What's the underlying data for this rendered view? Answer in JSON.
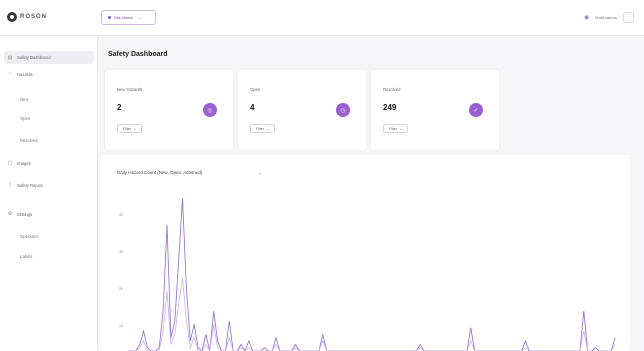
{
  "header": {
    "logo_text": "ROSON",
    "site_label": "Site Name",
    "notifications_label": "Notifications"
  },
  "sidebar": {
    "items": [
      {
        "label": "Safety Dashboard",
        "icon": "dashboard-icon"
      },
      {
        "label": "Hazards",
        "icon": "alert-icon"
      },
      {
        "label": "New",
        "icon": ""
      },
      {
        "label": "Open",
        "icon": ""
      },
      {
        "label": "Resolved",
        "icon": ""
      },
      {
        "label": "Images",
        "icon": "image-icon"
      },
      {
        "label": "Safety Report",
        "icon": "report-icon"
      },
      {
        "label": "Settings",
        "icon": "gear-icon"
      },
      {
        "label": "Operators",
        "icon": ""
      },
      {
        "label": "Labels",
        "icon": ""
      }
    ]
  },
  "page": {
    "title": "Safety Dashboard"
  },
  "cards": [
    {
      "label": "New Hazards",
      "value": "2",
      "filter": "Filter"
    },
    {
      "label": "Open",
      "value": "4",
      "filter": "Filter"
    },
    {
      "label": "Resolved",
      "value": "249",
      "filter": "Filter"
    }
  ],
  "chart": {
    "title": "Daily Hazard Count (New, Open, Actioned)",
    "dropdown_icon": "chevron-down-icon"
  },
  "colors": {
    "accent": "#9b5fd3",
    "line": "#8e6bc9"
  },
  "chart_data": {
    "type": "line",
    "title": "Daily Hazard Count (New, Open, Actioned)",
    "y_ticks": [
      "40",
      "30",
      "20",
      "10"
    ],
    "ylim": [
      0,
      50
    ],
    "series": [
      {
        "values": [
          0,
          0,
          0,
          2,
          6,
          1,
          0,
          0,
          1,
          12,
          38,
          4,
          9,
          27,
          46,
          19,
          3,
          8,
          1,
          0,
          5,
          0,
          12,
          3,
          0,
          0,
          9,
          0,
          0,
          2,
          0,
          3,
          0,
          0,
          0,
          1,
          0,
          0,
          4,
          0,
          0,
          0,
          0,
          2,
          0,
          0,
          0,
          0,
          0,
          0,
          5,
          0,
          0,
          0,
          0,
          0,
          0,
          0,
          0,
          0,
          0,
          0,
          0,
          0,
          0,
          0,
          0,
          0,
          0,
          0,
          0,
          0,
          0,
          0,
          0,
          2,
          0,
          0,
          0,
          0,
          0,
          0,
          0,
          0,
          0,
          0,
          0,
          0,
          7,
          0,
          0,
          0,
          0,
          0,
          0,
          0,
          0,
          0,
          0,
          0,
          0,
          0,
          3,
          0,
          0,
          0,
          0,
          0,
          0,
          0,
          0,
          0,
          0,
          0,
          0,
          0,
          0,
          12,
          0,
          0,
          1,
          0,
          0,
          0,
          0,
          4
        ]
      },
      {
        "values": [
          0,
          0,
          0,
          1,
          3,
          0,
          0,
          0,
          0,
          6,
          18,
          2,
          5,
          14,
          22,
          9,
          1,
          4,
          0,
          0,
          2,
          0,
          8,
          1,
          0,
          0,
          4,
          0,
          0,
          1,
          0,
          1,
          0,
          0,
          0,
          0,
          0,
          0,
          2,
          0,
          0,
          0,
          0,
          1,
          0,
          0,
          0,
          0,
          0,
          0,
          3,
          0,
          0,
          0,
          0,
          0,
          0,
          0,
          0,
          0,
          0,
          0,
          0,
          0,
          0,
          0,
          0,
          0,
          0,
          0,
          0,
          0,
          0,
          0,
          0,
          1,
          0,
          0,
          0,
          0,
          0,
          0,
          0,
          0,
          0,
          0,
          0,
          0,
          3,
          0,
          0,
          0,
          0,
          0,
          0,
          0,
          0,
          0,
          0,
          0,
          0,
          0,
          1,
          0,
          0,
          0,
          0,
          0,
          0,
          0,
          0,
          0,
          0,
          0,
          0,
          0,
          0,
          6,
          0,
          0,
          0,
          0,
          0,
          0,
          0,
          2
        ]
      }
    ]
  }
}
